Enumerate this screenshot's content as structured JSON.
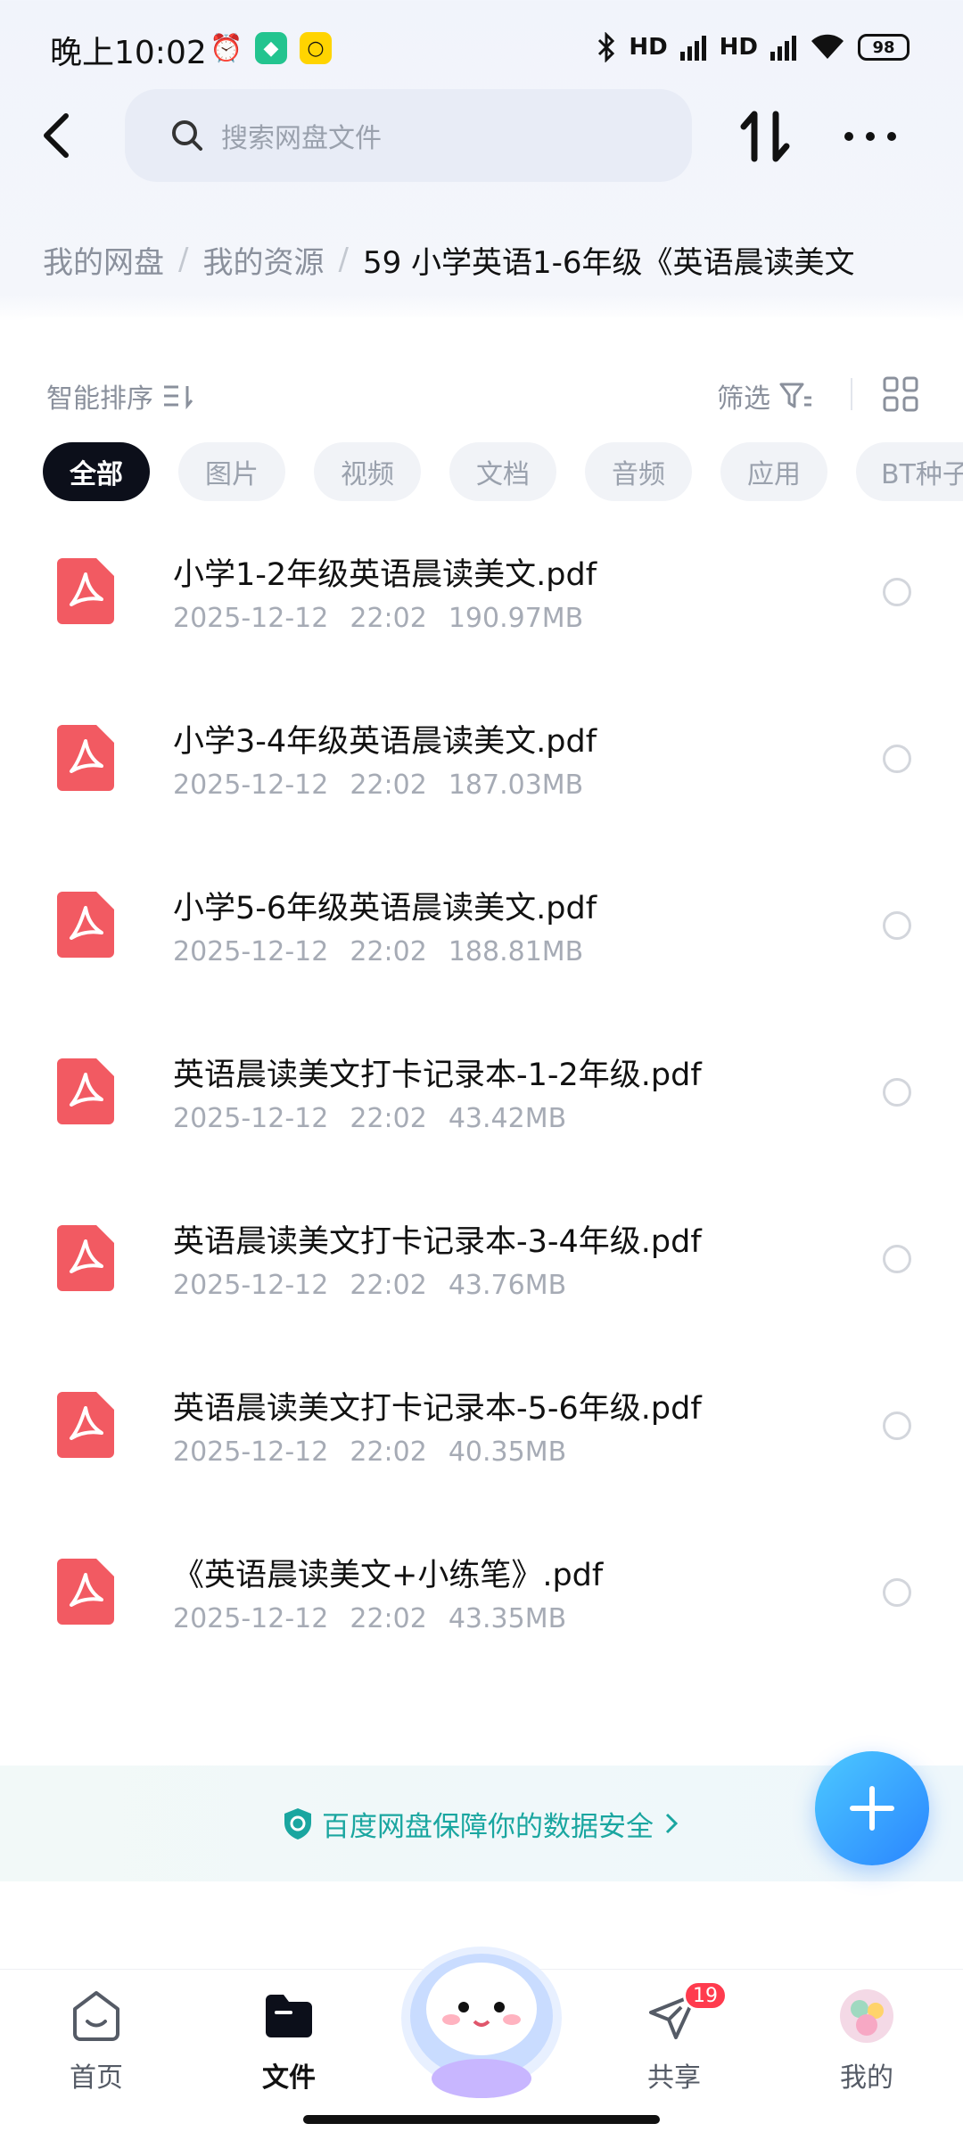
{
  "status_bar": {
    "time": "晚上10:02",
    "battery": "98",
    "signal_label_1": "HD",
    "signal_label_2": "HD"
  },
  "header": {
    "search_placeholder": "搜索网盘文件"
  },
  "breadcrumb": {
    "items": [
      "我的网盘",
      "我的资源"
    ],
    "current": "59  小学英语1-6年级《英语晨读美文"
  },
  "toolbar": {
    "sort_label": "智能排序",
    "filter_label": "筛选"
  },
  "chips": [
    "全部",
    "图片",
    "视频",
    "文档",
    "音频",
    "应用",
    "BT种子"
  ],
  "files": [
    {
      "name": "小学1-2年级英语晨读美文.pdf",
      "date": "2025-12-12",
      "time": "22:02",
      "size": "190.97MB"
    },
    {
      "name": "小学3-4年级英语晨读美文.pdf",
      "date": "2025-12-12",
      "time": "22:02",
      "size": "187.03MB"
    },
    {
      "name": "小学5-6年级英语晨读美文.pdf",
      "date": "2025-12-12",
      "time": "22:02",
      "size": "188.81MB"
    },
    {
      "name": "英语晨读美文打卡记录本-1-2年级.pdf",
      "date": "2025-12-12",
      "time": "22:02",
      "size": "43.42MB"
    },
    {
      "name": "英语晨读美文打卡记录本-3-4年级.pdf",
      "date": "2025-12-12",
      "time": "22:02",
      "size": "43.76MB"
    },
    {
      "name": "英语晨读美文打卡记录本-5-6年级.pdf",
      "date": "2025-12-12",
      "time": "22:02",
      "size": "40.35MB"
    },
    {
      "name": "《英语晨读美文+小练笔》.pdf",
      "date": "2025-12-12",
      "time": "22:02",
      "size": "43.35MB"
    }
  ],
  "safety_banner": "百度网盘保障你的数据安全",
  "bottom_nav": {
    "home": "首页",
    "files": "文件",
    "share": "共享",
    "share_badge": "19",
    "mine": "我的"
  },
  "colors": {
    "accent": "#2a85ff",
    "pdf_red": "#f25a62",
    "safety_teal": "#1aa6a0",
    "badge_red": "#ff3b4e"
  }
}
